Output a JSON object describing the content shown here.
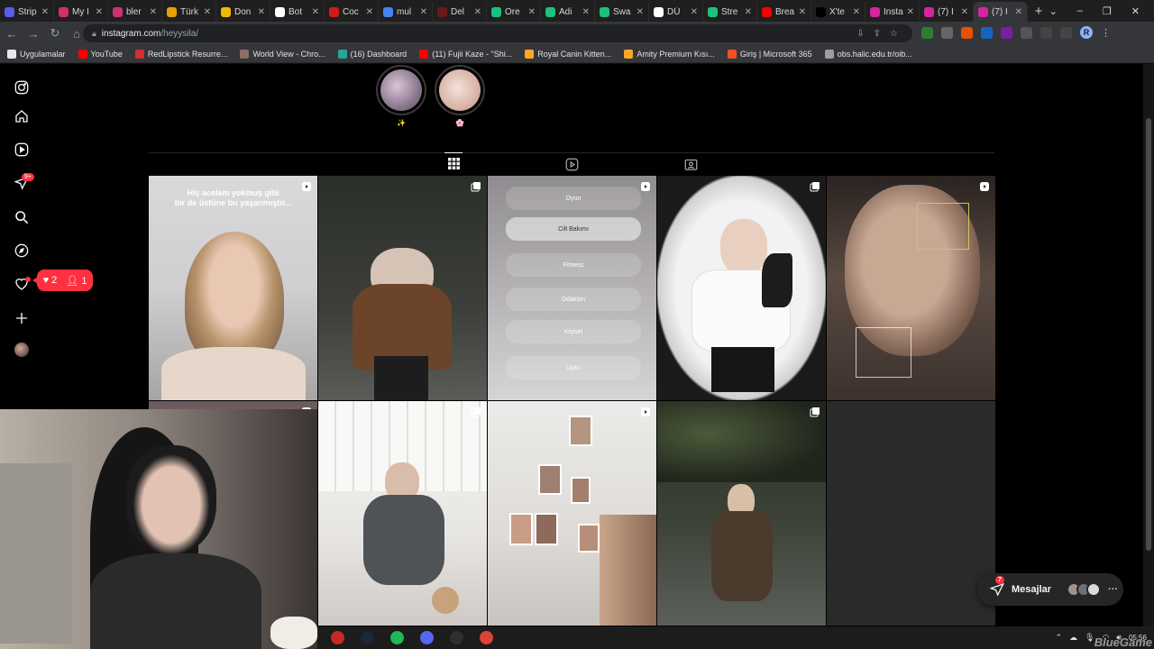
{
  "browser": {
    "tabs": [
      {
        "label": "Strip",
        "color": "#5b5bf0"
      },
      {
        "label": "My I",
        "color": "#d1306f"
      },
      {
        "label": "bler",
        "color": "#d1306f"
      },
      {
        "label": "Türk",
        "color": "#e6a000"
      },
      {
        "label": "Don",
        "color": "#f3b800"
      },
      {
        "label": "Bot",
        "color": "#ffffff"
      },
      {
        "label": "Coc",
        "color": "#d11a1a"
      },
      {
        "label": "mul",
        "color": "#4285f4"
      },
      {
        "label": "Del",
        "color": "#6b1a1a"
      },
      {
        "label": "Ore",
        "color": "#19c37d"
      },
      {
        "label": "Adi",
        "color": "#19c37d"
      },
      {
        "label": "Swa",
        "color": "#19c37d"
      },
      {
        "label": "DÜ",
        "color": "#ffffff"
      },
      {
        "label": "Stre",
        "color": "#19c37d"
      },
      {
        "label": "Brea",
        "color": "#ff0000"
      },
      {
        "label": "X'te",
        "color": "#000000"
      },
      {
        "label": "Insta",
        "color": "#d6249f"
      },
      {
        "label": "(7) I",
        "color": "#d6249f"
      },
      {
        "label": "(7) I",
        "color": "#d6249f"
      }
    ],
    "url_host": "instagram.com",
    "url_path": "/heyysila/",
    "profile_initial": "R",
    "bookmarks": [
      {
        "label": "Uygulamalar",
        "color": "#e8e8e8"
      },
      {
        "label": "YouTube",
        "color": "#ff0000"
      },
      {
        "label": "RedLipstick Resurre...",
        "color": "#d32f2f"
      },
      {
        "label": "World View - Chro...",
        "color": "#8d6e63"
      },
      {
        "label": "(16) Dashboard",
        "color": "#26a69a"
      },
      {
        "label": "(11) Fujii Kaze - \"Shi...",
        "color": "#ff0000"
      },
      {
        "label": "Royal Canin Kitten...",
        "color": "#f9a825"
      },
      {
        "label": "Amity Premium Kısı...",
        "color": "#f9a825"
      },
      {
        "label": "Giriş | Microsoft 365",
        "color": "#f25022"
      },
      {
        "label": "obs.halic.edu.tr/oib...",
        "color": "#9e9e9e"
      }
    ]
  },
  "instagram": {
    "notification_badge": "9+",
    "activity_likes": "2",
    "activity_follows": "1",
    "highlight_labels": [
      "✨",
      "🌸"
    ],
    "posts": [
      {
        "caption": "Hiç acelem yokmuş gibi\nbir de üstüne bu yaşanmıştır...",
        "type": "reel"
      },
      {
        "caption": "",
        "type": "carousel"
      },
      {
        "caption": "",
        "type": "reel"
      },
      {
        "caption": "",
        "type": "carousel"
      },
      {
        "caption": "",
        "type": "reel"
      },
      {
        "caption": "",
        "type": "carousel"
      },
      {
        "caption": "",
        "type": "reel"
      },
      {
        "caption": "",
        "type": "carousel"
      },
      {
        "caption": "",
        "type": "reel"
      },
      {
        "caption": "",
        "type": "carousel"
      }
    ],
    "control_center": [
      "Oyun",
      "Cilt Bakımı",
      "Fitness",
      "Odaklan",
      "Kişisel",
      "Uyku"
    ],
    "messages_label": "Mesajlar",
    "messages_count": "7"
  },
  "taskbar": {
    "time": "05:56",
    "apps": [
      {
        "name": "voicemod-icon",
        "color": "#c62828"
      },
      {
        "name": "steam-icon",
        "color": "#1b2838"
      },
      {
        "name": "spotify-icon",
        "color": "#1db954"
      },
      {
        "name": "discord-icon",
        "color": "#5865f2"
      },
      {
        "name": "obs-icon",
        "color": "#302e31"
      },
      {
        "name": "chrome-icon",
        "color": "#db4437"
      }
    ],
    "watermark": "BlueGame"
  }
}
